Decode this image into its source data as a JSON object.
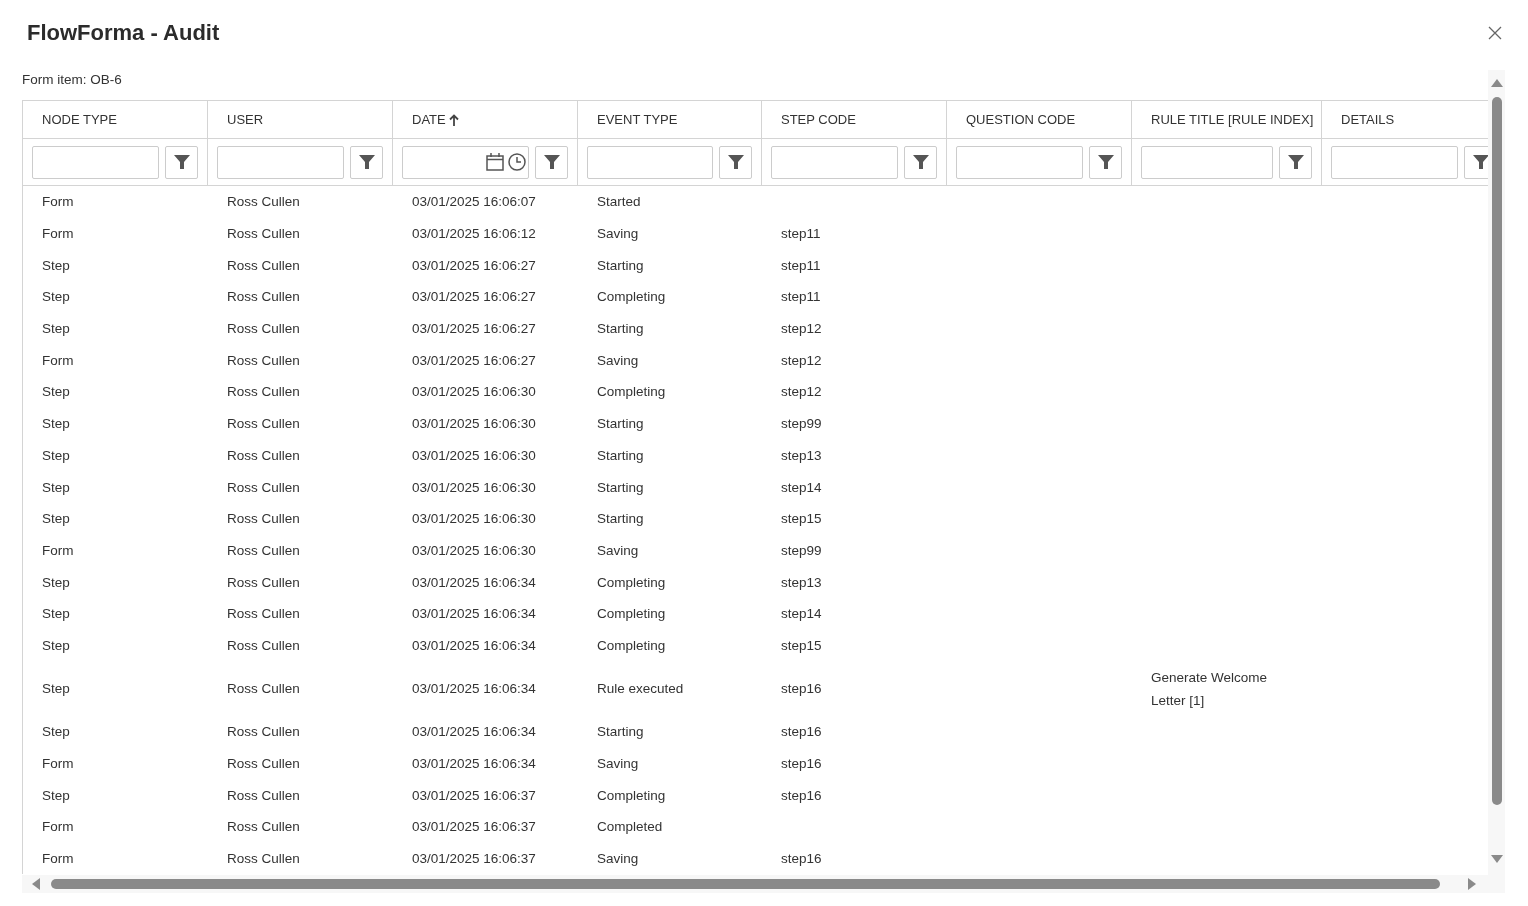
{
  "dialog": {
    "title": "FlowForma - Audit"
  },
  "form_item": "Form item: OB-6",
  "table": {
    "columns": [
      {
        "label": "NODE TYPE",
        "sorted": false,
        "kind": "text"
      },
      {
        "label": "USER",
        "sorted": false,
        "kind": "text"
      },
      {
        "label": "DATE",
        "sorted": true,
        "kind": "datetime"
      },
      {
        "label": "EVENT TYPE",
        "sorted": false,
        "kind": "text"
      },
      {
        "label": "STEP CODE",
        "sorted": false,
        "kind": "text"
      },
      {
        "label": "QUESTION CODE",
        "sorted": false,
        "kind": "text"
      },
      {
        "label": "RULE TITLE [RULE INDEX]",
        "sorted": false,
        "kind": "text"
      },
      {
        "label": "DETAILS",
        "sorted": false,
        "kind": "text"
      }
    ],
    "rows": [
      {
        "node_type": "Form",
        "user": "Ross Cullen",
        "date": "03/01/2025 16:06:07",
        "event_type": "Started"
      },
      {
        "node_type": "Form",
        "user": "Ross Cullen",
        "date": "03/01/2025 16:06:12",
        "event_type": "Saving",
        "step_code": "step11"
      },
      {
        "node_type": "Step",
        "user": "Ross Cullen",
        "date": "03/01/2025 16:06:27",
        "event_type": "Starting",
        "step_code": "step11"
      },
      {
        "node_type": "Step",
        "user": "Ross Cullen",
        "date": "03/01/2025 16:06:27",
        "event_type": "Completing",
        "step_code": "step11"
      },
      {
        "node_type": "Step",
        "user": "Ross Cullen",
        "date": "03/01/2025 16:06:27",
        "event_type": "Starting",
        "step_code": "step12"
      },
      {
        "node_type": "Form",
        "user": "Ross Cullen",
        "date": "03/01/2025 16:06:27",
        "event_type": "Saving",
        "step_code": "step12"
      },
      {
        "node_type": "Step",
        "user": "Ross Cullen",
        "date": "03/01/2025 16:06:30",
        "event_type": "Completing",
        "step_code": "step12"
      },
      {
        "node_type": "Step",
        "user": "Ross Cullen",
        "date": "03/01/2025 16:06:30",
        "event_type": "Starting",
        "step_code": "step99"
      },
      {
        "node_type": "Step",
        "user": "Ross Cullen",
        "date": "03/01/2025 16:06:30",
        "event_type": "Starting",
        "step_code": "step13"
      },
      {
        "node_type": "Step",
        "user": "Ross Cullen",
        "date": "03/01/2025 16:06:30",
        "event_type": "Starting",
        "step_code": "step14"
      },
      {
        "node_type": "Step",
        "user": "Ross Cullen",
        "date": "03/01/2025 16:06:30",
        "event_type": "Starting",
        "step_code": "step15"
      },
      {
        "node_type": "Form",
        "user": "Ross Cullen",
        "date": "03/01/2025 16:06:30",
        "event_type": "Saving",
        "step_code": "step99"
      },
      {
        "node_type": "Step",
        "user": "Ross Cullen",
        "date": "03/01/2025 16:06:34",
        "event_type": "Completing",
        "step_code": "step13"
      },
      {
        "node_type": "Step",
        "user": "Ross Cullen",
        "date": "03/01/2025 16:06:34",
        "event_type": "Completing",
        "step_code": "step14"
      },
      {
        "node_type": "Step",
        "user": "Ross Cullen",
        "date": "03/01/2025 16:06:34",
        "event_type": "Completing",
        "step_code": "step15"
      },
      {
        "node_type": "Step",
        "user": "Ross Cullen",
        "date": "03/01/2025 16:06:34",
        "event_type": "Rule executed",
        "step_code": "step16",
        "rule_title": "Generate Welcome Letter [1]"
      },
      {
        "node_type": "Step",
        "user": "Ross Cullen",
        "date": "03/01/2025 16:06:34",
        "event_type": "Starting",
        "step_code": "step16"
      },
      {
        "node_type": "Form",
        "user": "Ross Cullen",
        "date": "03/01/2025 16:06:34",
        "event_type": "Saving",
        "step_code": "step16"
      },
      {
        "node_type": "Step",
        "user": "Ross Cullen",
        "date": "03/01/2025 16:06:37",
        "event_type": "Completing",
        "step_code": "step16"
      },
      {
        "node_type": "Form",
        "user": "Ross Cullen",
        "date": "03/01/2025 16:06:37",
        "event_type": "Completed"
      },
      {
        "node_type": "Form",
        "user": "Ross Cullen",
        "date": "03/01/2025 16:06:37",
        "event_type": "Saving",
        "step_code": "step16"
      }
    ]
  }
}
